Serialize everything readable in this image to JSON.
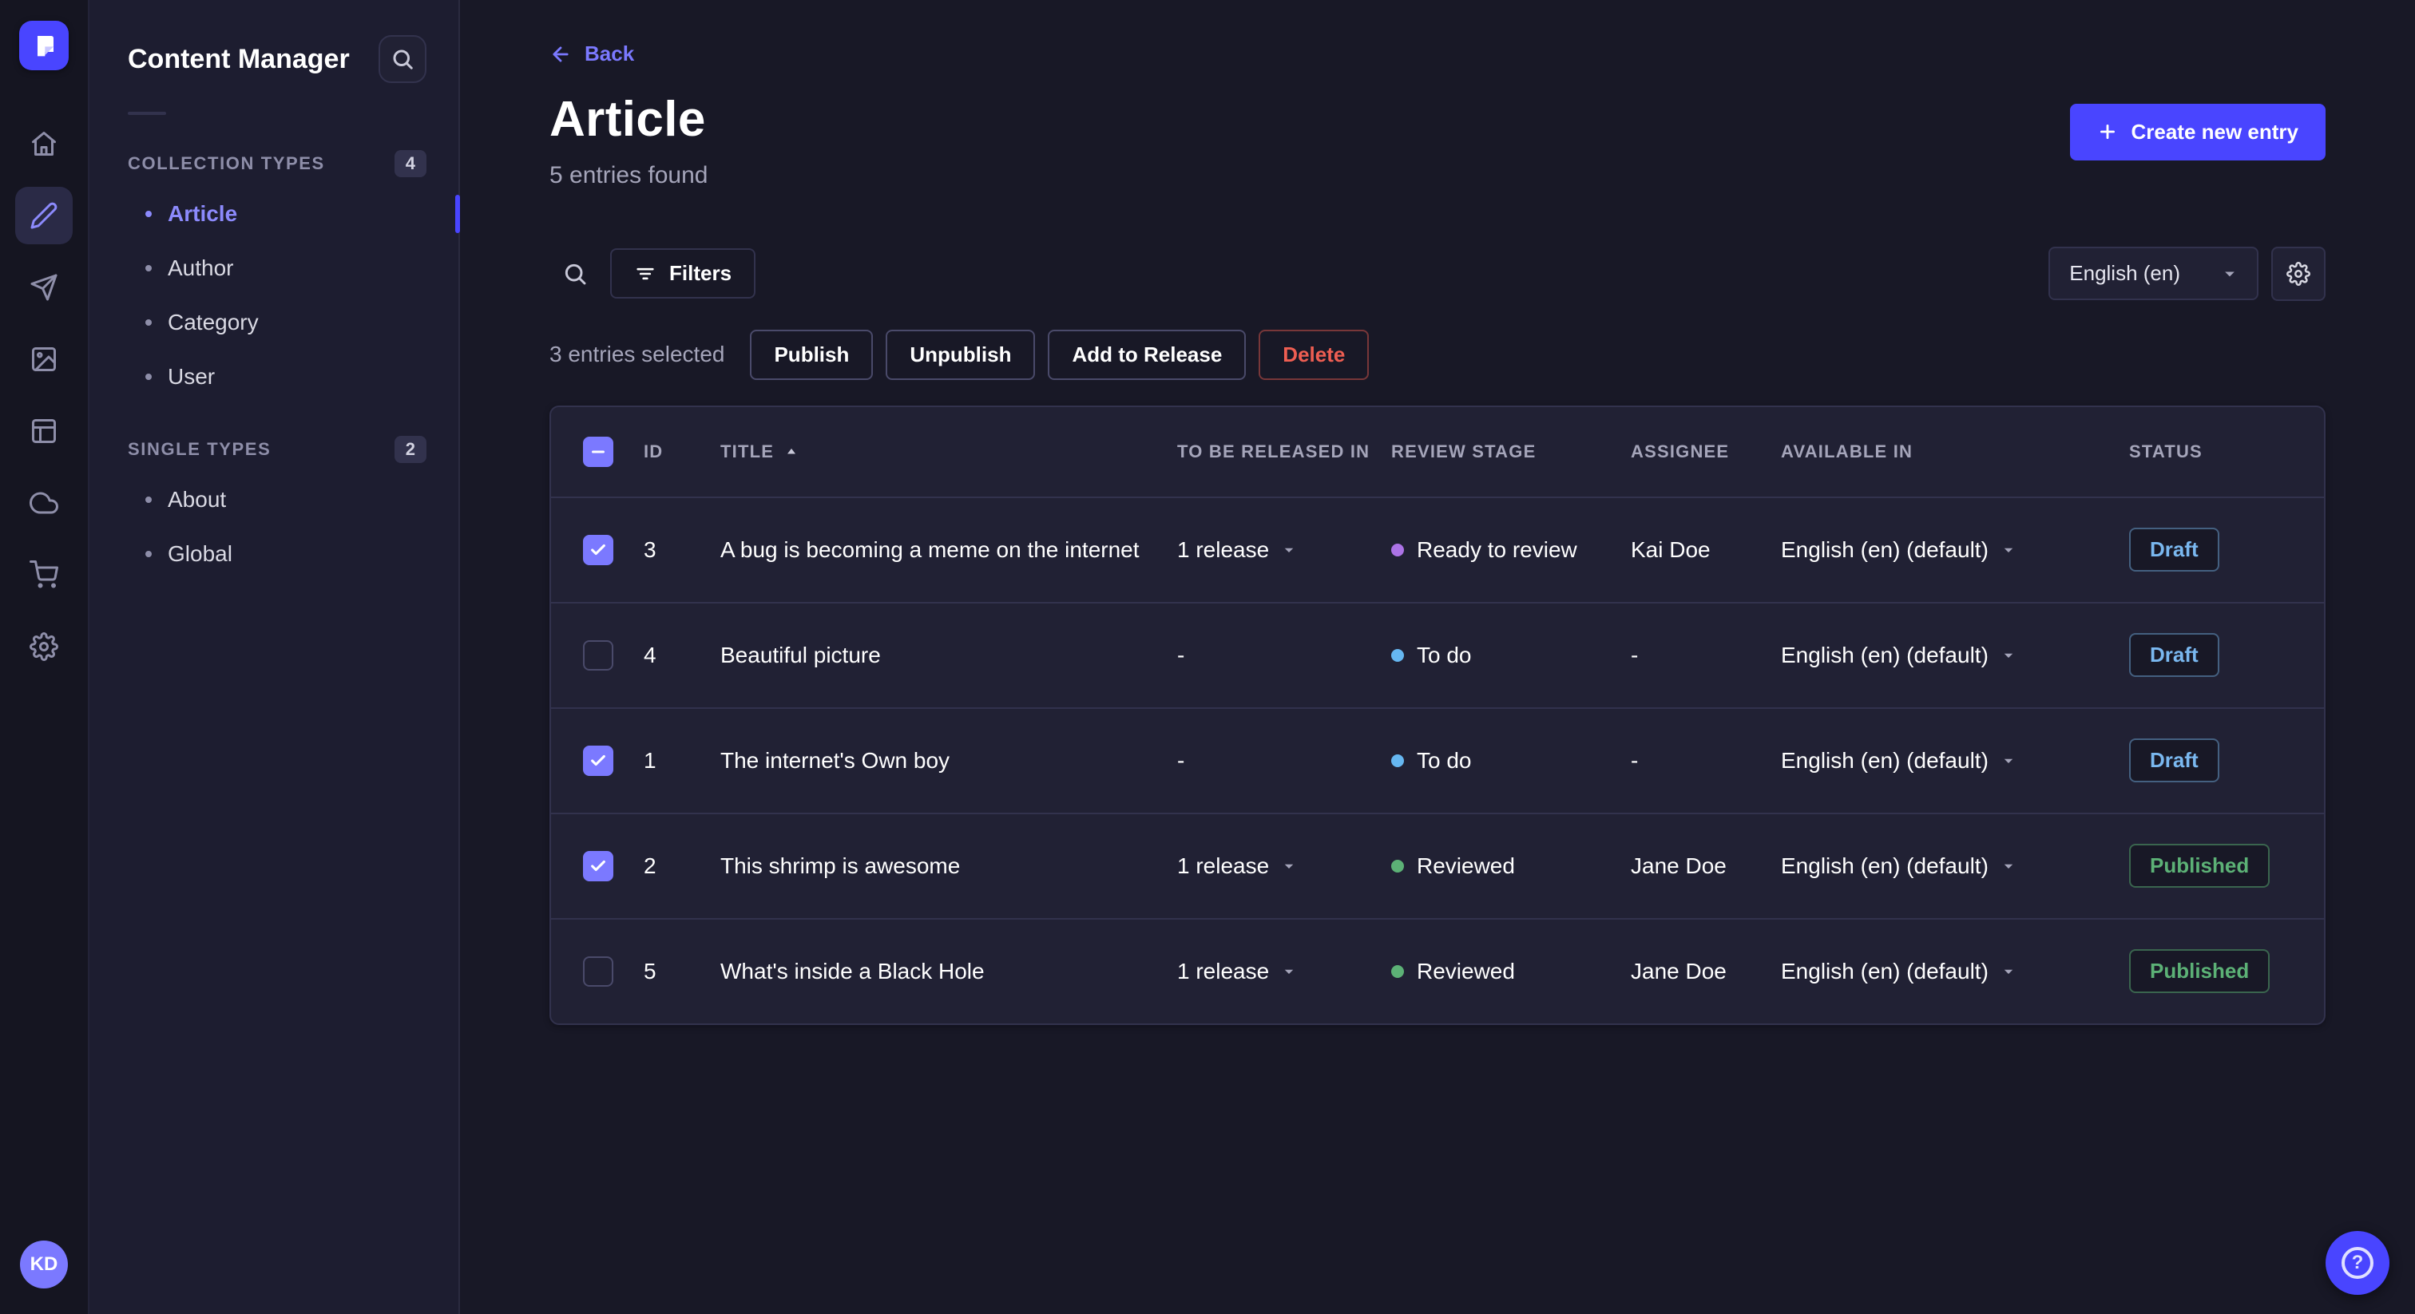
{
  "colors": {
    "accent": "#4945ff",
    "accent_light": "#7b79ff",
    "draft_blue": "#7ab8f0",
    "published_green": "#5cb176",
    "danger_red": "#ee5e52",
    "stage_ready_to_review": "#ac73e6",
    "stage_to_do": "#66b7f1",
    "stage_reviewed": "#5cb176"
  },
  "nav_rail": {
    "logo_icon": "strapi-logo",
    "items": [
      {
        "icon": "home-icon",
        "active": false
      },
      {
        "icon": "content-manager-icon",
        "active": true
      },
      {
        "icon": "releases-icon",
        "active": false
      },
      {
        "icon": "media-library-icon",
        "active": false
      },
      {
        "icon": "content-type-builder-icon",
        "active": false
      },
      {
        "icon": "deploy-icon",
        "active": false
      },
      {
        "icon": "marketplace-icon",
        "active": false
      },
      {
        "icon": "settings-icon",
        "active": false
      }
    ],
    "avatar_initials": "KD"
  },
  "sidebar": {
    "title": "Content Manager",
    "search_icon": "search-icon",
    "sections": [
      {
        "label": "COLLECTION TYPES",
        "badge": "4",
        "items": [
          {
            "label": "Article",
            "active": true
          },
          {
            "label": "Author",
            "active": false
          },
          {
            "label": "Category",
            "active": false
          },
          {
            "label": "User",
            "active": false
          }
        ]
      },
      {
        "label": "SINGLE TYPES",
        "badge": "2",
        "items": [
          {
            "label": "About",
            "active": false
          },
          {
            "label": "Global",
            "active": false
          }
        ]
      }
    ]
  },
  "header": {
    "back_label": "Back",
    "title": "Article",
    "subtitle": "5 entries found",
    "create_button_label": "Create new entry"
  },
  "toolbar": {
    "filters_label": "Filters",
    "locale_value": "English (en)"
  },
  "selection": {
    "text": "3 entries selected",
    "actions": {
      "publish": "Publish",
      "unpublish": "Unpublish",
      "add_to_release": "Add to Release",
      "delete": "Delete"
    }
  },
  "table": {
    "columns": [
      "ID",
      "TITLE",
      "TO BE RELEASED IN",
      "REVIEW STAGE",
      "ASSIGNEE",
      "AVAILABLE IN",
      "STATUS"
    ],
    "sort_column": "TITLE",
    "sort_direction": "ascending",
    "rows": [
      {
        "checked": true,
        "id": "3",
        "title": "A bug is becoming a meme on the internet",
        "release": "1 release",
        "stage": "Ready to review",
        "stage_color": "#ac73e6",
        "assignee": "Kai Doe",
        "locale": "English (en) (default)",
        "status": "Draft"
      },
      {
        "checked": false,
        "id": "4",
        "title": "Beautiful picture",
        "release": "-",
        "stage": "To do",
        "stage_color": "#66b7f1",
        "assignee": "-",
        "locale": "English (en) (default)",
        "status": "Draft"
      },
      {
        "checked": true,
        "id": "1",
        "title": "The internet's Own boy",
        "release": "-",
        "stage": "To do",
        "stage_color": "#66b7f1",
        "assignee": "-",
        "locale": "English (en) (default)",
        "status": "Draft"
      },
      {
        "checked": true,
        "id": "2",
        "title": "This shrimp is awesome",
        "release": "1 release",
        "stage": "Reviewed",
        "stage_color": "#5cb176",
        "assignee": "Jane Doe",
        "locale": "English (en) (default)",
        "status": "Published"
      },
      {
        "checked": false,
        "id": "5",
        "title": "What's inside a Black Hole",
        "release": "1 release",
        "stage": "Reviewed",
        "stage_color": "#5cb176",
        "assignee": "Jane Doe",
        "locale": "English (en) (default)",
        "status": "Published"
      }
    ]
  },
  "help": {
    "icon": "question-mark-icon"
  }
}
